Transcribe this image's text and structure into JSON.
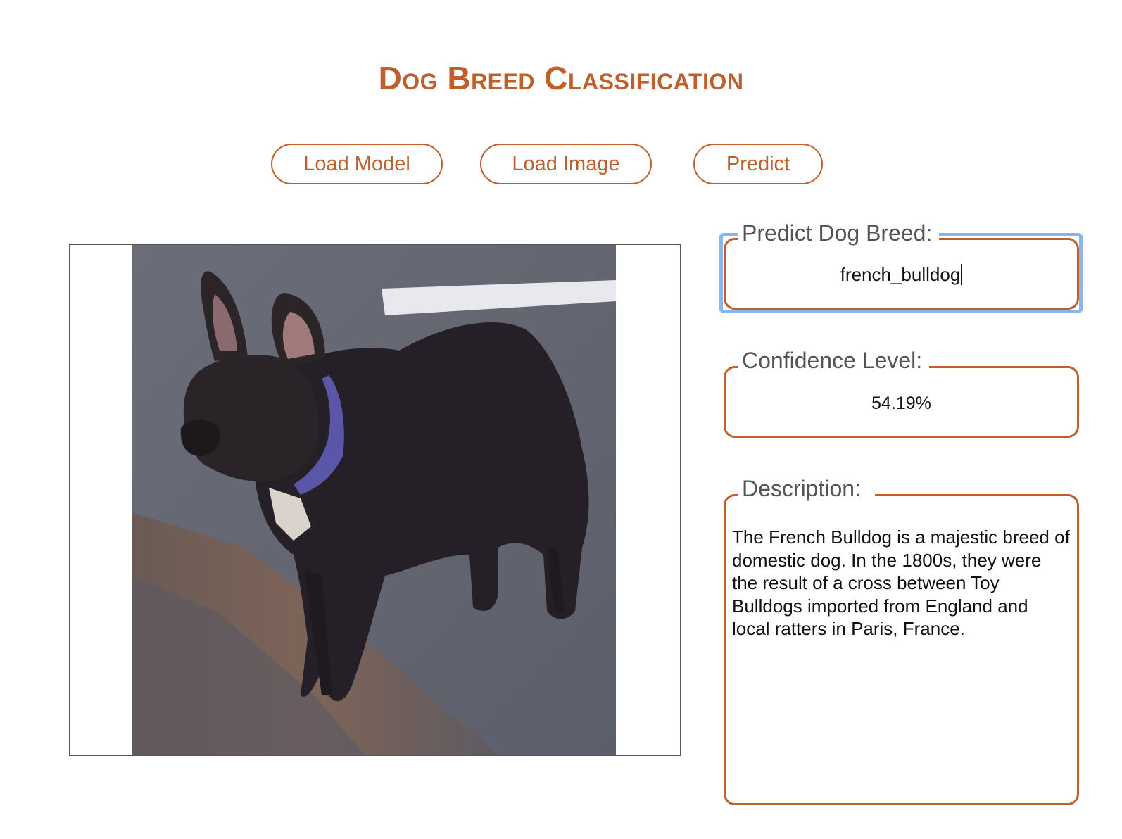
{
  "header": {
    "title": "Dog Breed Classification"
  },
  "toolbar": {
    "load_model_label": "Load Model",
    "load_image_label": "Load Image",
    "predict_label": "Predict"
  },
  "prediction": {
    "breed_label": "Predict Dog Breed:",
    "breed_value": "french_bulldog",
    "confidence_label": "Confidence Level:",
    "confidence_value": "54.19%",
    "description_label": "Description:",
    "description_value": "The French Bulldog is a majestic breed of domestic dog. In the 1800s, they were the result of a cross between Toy Bulldogs imported from England and local ratters in Paris, France."
  },
  "colors": {
    "accent": "#bf5f2c",
    "focus": "#8ab6f0",
    "label_text": "#555555"
  },
  "icons": {
    "image_content": "french-bulldog-photo"
  }
}
